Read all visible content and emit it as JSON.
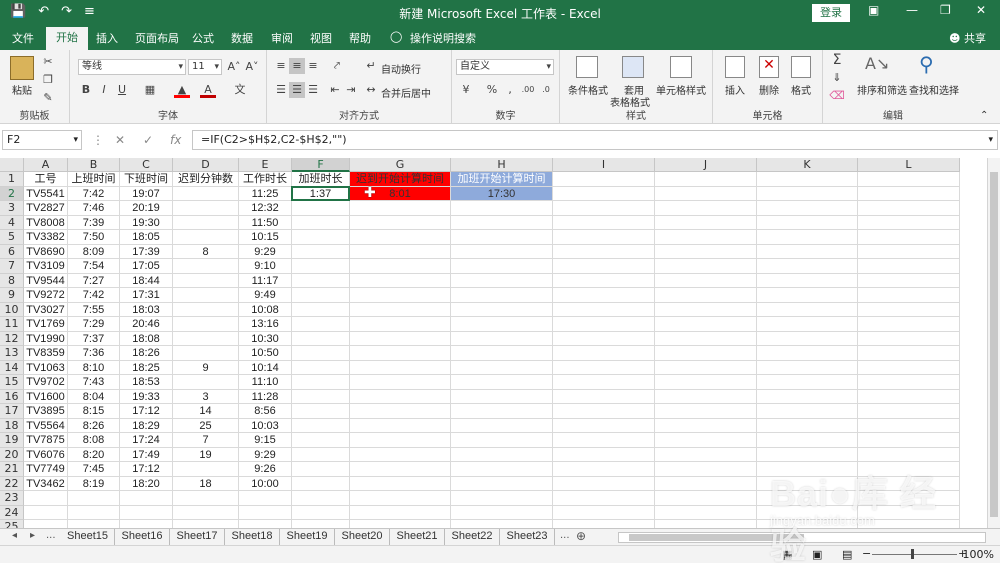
{
  "window": {
    "title": "新建 Microsoft Excel 工作表 - Excel",
    "login": "登录",
    "min": "—",
    "restore": "❐",
    "close": "✕",
    "ribbon_toggle": "▣"
  },
  "quick_access": {
    "save": "💾",
    "undo": "↶",
    "redo": "↷",
    "more": "≡"
  },
  "tabs": [
    "文件",
    "开始",
    "插入",
    "页面布局",
    "公式",
    "数据",
    "审阅",
    "视图",
    "帮助",
    "操作说明搜索"
  ],
  "active_tab": "开始",
  "share": "共享",
  "ribbon": {
    "clipboard": {
      "label": "剪贴板",
      "paste": "粘贴"
    },
    "font": {
      "label": "字体",
      "name": "等线",
      "size": "11",
      "bold": "B",
      "italic": "I",
      "underline": "U",
      "grow": "A˄",
      "shrink": "A˅",
      "phonetic": "文"
    },
    "align": {
      "label": "对齐方式",
      "wrap": "自动换行",
      "merge": "合并后居中"
    },
    "number": {
      "label": "数字",
      "format": "自定义",
      "percent": "%",
      "comma": "‚",
      "inc": ".00",
      "dec": ".0"
    },
    "styles": {
      "label": "样式",
      "conditional": "条件格式",
      "table1": "套用",
      "table2": "表格格式",
      "cell": "单元格样式"
    },
    "cells": {
      "label": "单元格",
      "insert": "插入",
      "delete": "删除",
      "format": "格式"
    },
    "edit": {
      "label": "编辑",
      "sort": "排序和筛选",
      "find": "查找和选择",
      "sum": "Σ"
    }
  },
  "formula_bar": {
    "name_box": "F2",
    "cancel": "✕",
    "enter": "✓",
    "fx": "fx",
    "formula": "=IF(C2>$H$2,C2-$H$2,\"\")"
  },
  "columns": [
    "A",
    "B",
    "C",
    "D",
    "E",
    "F",
    "G",
    "H",
    "I",
    "J",
    "K",
    "L"
  ],
  "rows": [
    "1",
    "2",
    "3",
    "4",
    "5",
    "6",
    "7",
    "8",
    "9",
    "10",
    "11",
    "12",
    "13",
    "14",
    "15",
    "16",
    "17",
    "18",
    "19",
    "20",
    "21",
    "22",
    "23",
    "24",
    "25"
  ],
  "headers": {
    "A": "工号",
    "B": "上班时间",
    "C": "下班时间",
    "D": "迟到分钟数",
    "E": "工作时长",
    "F": "加班时长",
    "G": "迟到开始计算时间",
    "H": "加班开始计算时间"
  },
  "special": {
    "F2": "1:37",
    "G2": "8:01",
    "H2": "17:30"
  },
  "colors": {
    "G_fill": "#ff0000",
    "H_fill": "#8eaadb",
    "accent": "#217346"
  },
  "data": [
    [
      "TV5541",
      "7:42",
      "19:07",
      "",
      "11:25"
    ],
    [
      "TV2827",
      "7:46",
      "20:19",
      "",
      "12:32"
    ],
    [
      "TV8008",
      "7:39",
      "19:30",
      "",
      "11:50"
    ],
    [
      "TV3382",
      "7:50",
      "18:05",
      "",
      "10:15"
    ],
    [
      "TV8690",
      "8:09",
      "17:39",
      "8",
      "9:29"
    ],
    [
      "TV3109",
      "7:54",
      "17:05",
      "",
      "9:10"
    ],
    [
      "TV9544",
      "7:27",
      "18:44",
      "",
      "11:17"
    ],
    [
      "TV9272",
      "7:42",
      "17:31",
      "",
      "9:49"
    ],
    [
      "TV3027",
      "7:55",
      "18:03",
      "",
      "10:08"
    ],
    [
      "TV1769",
      "7:29",
      "20:46",
      "",
      "13:16"
    ],
    [
      "TV1990",
      "7:37",
      "18:08",
      "",
      "10:30"
    ],
    [
      "TV8359",
      "7:36",
      "18:26",
      "",
      "10:50"
    ],
    [
      "TV1063",
      "8:10",
      "18:25",
      "9",
      "10:14"
    ],
    [
      "TV9702",
      "7:43",
      "18:53",
      "",
      "11:10"
    ],
    [
      "TV1600",
      "8:04",
      "19:33",
      "3",
      "11:28"
    ],
    [
      "TV3895",
      "8:15",
      "17:12",
      "14",
      "8:56"
    ],
    [
      "TV5564",
      "8:26",
      "18:29",
      "25",
      "10:03"
    ],
    [
      "TV7875",
      "8:08",
      "17:24",
      "7",
      "9:15"
    ],
    [
      "TV6076",
      "8:20",
      "17:49",
      "19",
      "9:29"
    ],
    [
      "TV7749",
      "7:45",
      "17:12",
      "",
      "9:26"
    ],
    [
      "TV3462",
      "8:19",
      "18:20",
      "18",
      "10:00"
    ]
  ],
  "sheets": [
    "Sheet15",
    "Sheet16",
    "Sheet17",
    "Sheet18",
    "Sheet19",
    "Sheet20",
    "Sheet21",
    "Sheet22",
    "Sheet23"
  ],
  "sheet_nav": {
    "prev": "◂",
    "next": "▸",
    "more": "...",
    "more2": "...",
    "add": "⊕"
  },
  "status": {
    "zoom": "100%",
    "minus": "−",
    "plus": "+"
  },
  "watermark": {
    "brand": "Bai●库 经验",
    "url": "jingyan.baidu.com"
  }
}
